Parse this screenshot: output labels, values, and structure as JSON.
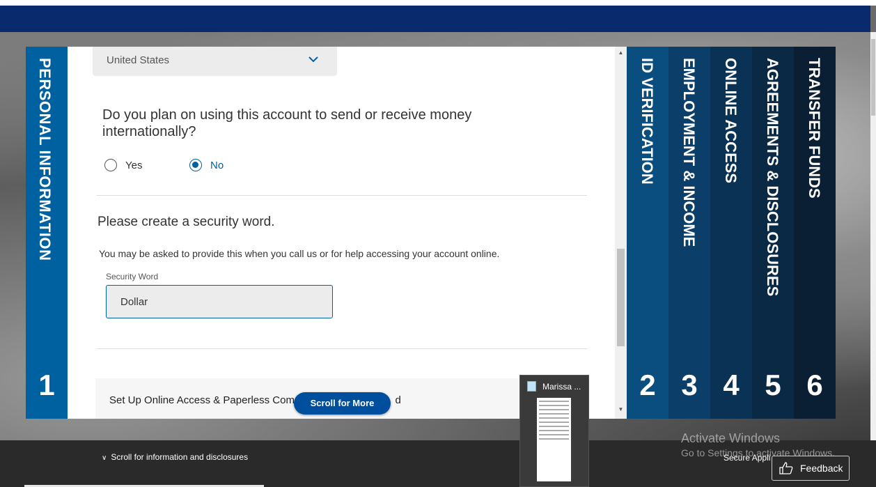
{
  "steps": [
    {
      "num": "1",
      "label": "PERSONAL INFORMATION",
      "color": "#0061a0"
    },
    {
      "num": "2",
      "label": "ID VERIFICATION",
      "color": "#0a4d7f"
    },
    {
      "num": "3",
      "label": "EMPLOYMENT & INCOME",
      "color": "#0b3f69"
    },
    {
      "num": "4",
      "label": "ONLINE ACCESS",
      "color": "#0a3255"
    },
    {
      "num": "5",
      "label": "AGREEMENTS & DISCLOSURES",
      "color": "#0a2944"
    },
    {
      "num": "6",
      "label": "TRANSFER FUNDS",
      "color": "#0a1f33"
    }
  ],
  "form": {
    "country_value": "United States",
    "question": "Do you plan on using this account to send or receive money internationally?",
    "options": [
      {
        "label": "Yes",
        "selected": false
      },
      {
        "label": "No",
        "selected": true
      }
    ],
    "security_title": "Please create a security word.",
    "security_desc": "You may be asked to provide this when you call us or for help accessing your account online.",
    "security_label": "Security Word",
    "security_value": "Dollar",
    "next_section": "Set Up Online Access & Paperless Comm",
    "next_section_suffix": "d"
  },
  "scroll_more": "Scroll for More",
  "bottom": {
    "info_link": "Scroll for information and disclosures",
    "secure": "Secure Appli",
    "feedback": "Feedback"
  },
  "activate": {
    "line1": "Activate Windows",
    "line2": "Go to Settings to activate Windows."
  },
  "taskbar_preview": {
    "title": "Marissa ...",
    "icon": "notepad-icon"
  },
  "colors": {
    "brand_blue": "#0061a0",
    "header_blue": "#0a2a6e",
    "button_blue": "#004f9e"
  }
}
